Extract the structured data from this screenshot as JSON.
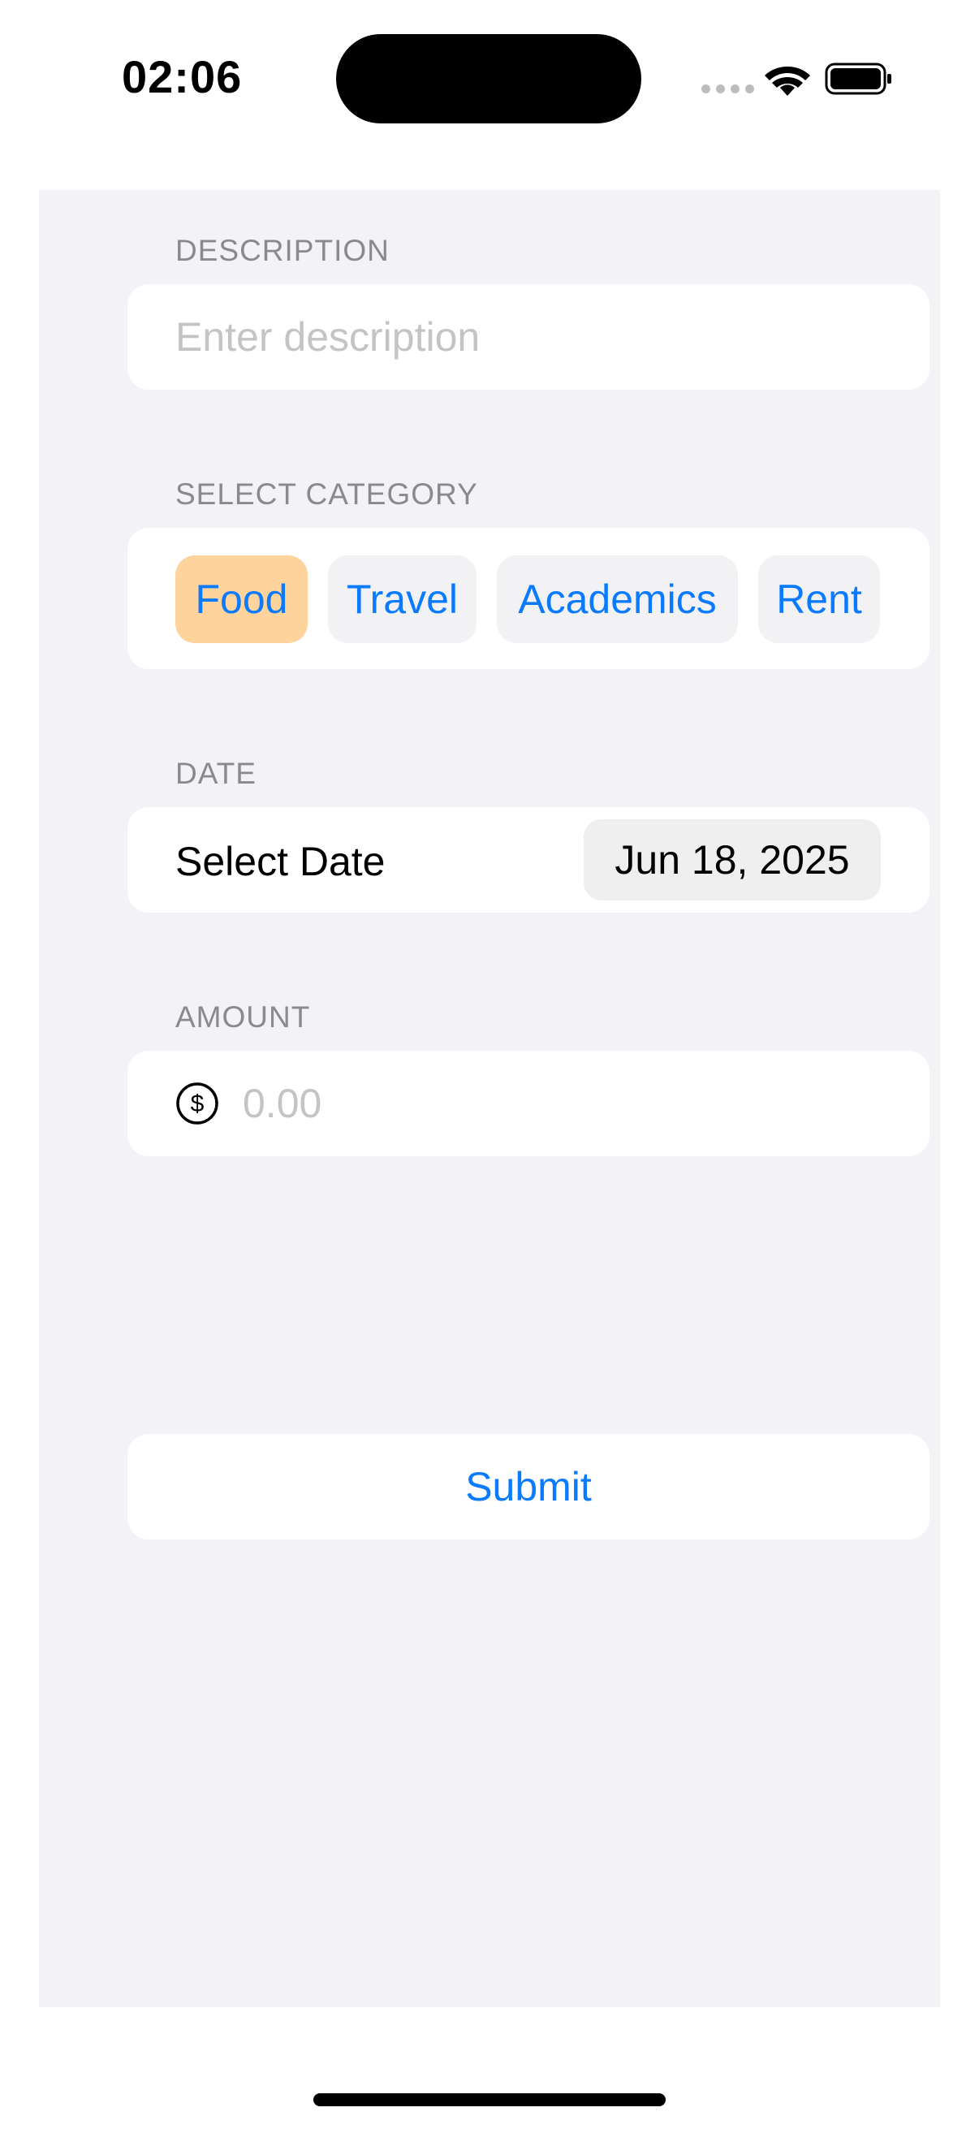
{
  "status_bar": {
    "time": "02:06",
    "icons": [
      "cellular-signal-icon",
      "wifi-icon",
      "battery-icon"
    ]
  },
  "form": {
    "description": {
      "label": "DESCRIPTION",
      "placeholder": "Enter description",
      "value": ""
    },
    "category": {
      "label": "SELECT CATEGORY",
      "options": [
        "Food",
        "Travel",
        "Academics",
        "Rent"
      ],
      "selected": "Food"
    },
    "date": {
      "label": "DATE",
      "field_label": "Select Date",
      "value": "Jun 18, 2025"
    },
    "amount": {
      "label": "AMOUNT",
      "icon": "dollar-sign-icon",
      "placeholder": "0.00",
      "value": ""
    },
    "submit_label": "Submit"
  },
  "colors": {
    "accent": "#0a7aff",
    "selected_chip": "#fed39c",
    "form_background": "#f2f2f7",
    "section_label": "#8a8a8e"
  }
}
